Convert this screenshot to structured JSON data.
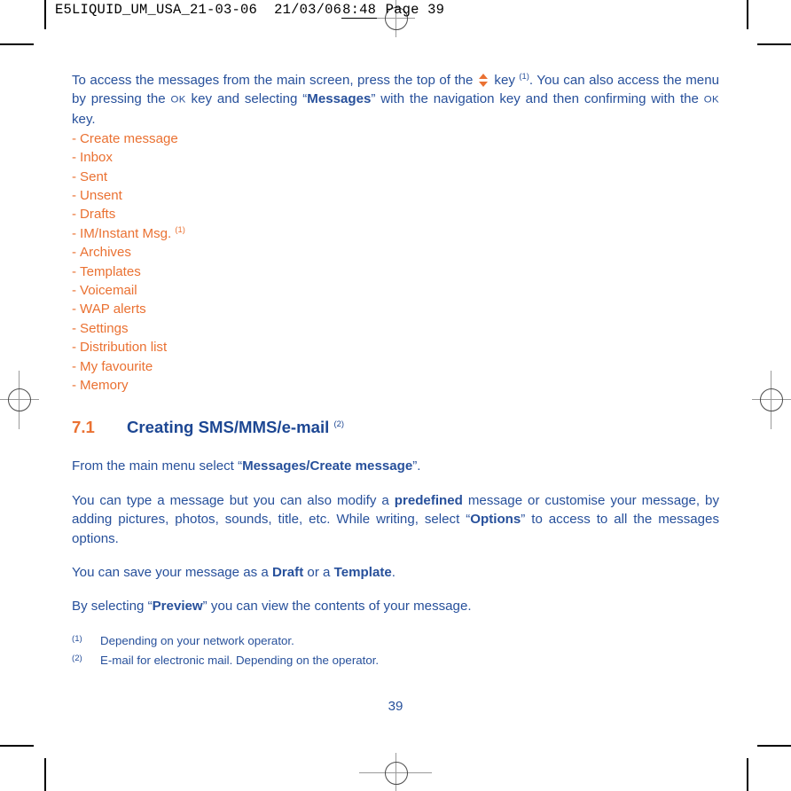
{
  "page": {
    "slug_left": "E5LIQUID_UM_USA_21-03-06",
    "slug_date": "21/03/06",
    "slug_time": "8:48",
    "slug_page": "Page 39",
    "page_number": "39"
  },
  "intro": {
    "part1": "To access the messages from the main screen, press the top of the ",
    "navkey_icon": "nav-updown-key-icon",
    "part2": " key ",
    "footnote_ref_1": "(1)",
    "part3": ". You can also access the menu by pressing the ",
    "ok_key": "OK",
    "part4": " key and selecting “",
    "bold_messages": "Messages",
    "part5": "” with the navigation key and then confirming with the ",
    "ok_key_2": "OK",
    "part6": " key."
  },
  "menu": {
    "dash": "-",
    "items": [
      {
        "label": "Create message",
        "footnote": ""
      },
      {
        "label": "Inbox",
        "footnote": ""
      },
      {
        "label": "Sent",
        "footnote": ""
      },
      {
        "label": "Unsent",
        "footnote": ""
      },
      {
        "label": "Drafts",
        "footnote": ""
      },
      {
        "label": "IM/Instant Msg.",
        "footnote": "(1)"
      },
      {
        "label": "Archives",
        "footnote": ""
      },
      {
        "label": "Templates",
        "footnote": ""
      },
      {
        "label": "Voicemail",
        "footnote": ""
      },
      {
        "label": "WAP alerts",
        "footnote": ""
      },
      {
        "label": "Settings",
        "footnote": ""
      },
      {
        "label": "Distribution list",
        "footnote": ""
      },
      {
        "label": "My favourite",
        "footnote": ""
      },
      {
        "label": "Memory",
        "footnote": ""
      }
    ]
  },
  "section": {
    "number": "7.1",
    "title": "Creating SMS/MMS/e-mail",
    "footnote_ref": "(2)"
  },
  "paragraphs": {
    "p1_a": "From the main menu select “",
    "p1_bold": "Messages/Create message",
    "p1_b": "”.",
    "p2_a": "You can type a message but you can also modify a ",
    "p2_bold1": "predefined",
    "p2_b": " message or customise your message, by adding pictures, photos, sounds, title, etc. While writing, select “",
    "p2_bold2": "Options",
    "p2_c": "” to access to all the messages options.",
    "p3_a": "You can save your message as a ",
    "p3_bold1": "Draft",
    "p3_b": " or a ",
    "p3_bold2": "Template",
    "p3_c": ".",
    "p4_a": "By selecting “",
    "p4_bold": "Preview",
    "p4_b": "” you can view the contents of your message."
  },
  "footnotes": [
    {
      "marker": "(1)",
      "text": "Depending on your network operator."
    },
    {
      "marker": "(2)",
      "text": "E-mail for electronic mail. Depending on the operator."
    }
  ],
  "colors": {
    "blue": "#27509b",
    "heading_blue": "#1d4793",
    "orange": "#ea7132",
    "crop_mark": "#000000",
    "registration": "#9a9a9a"
  }
}
